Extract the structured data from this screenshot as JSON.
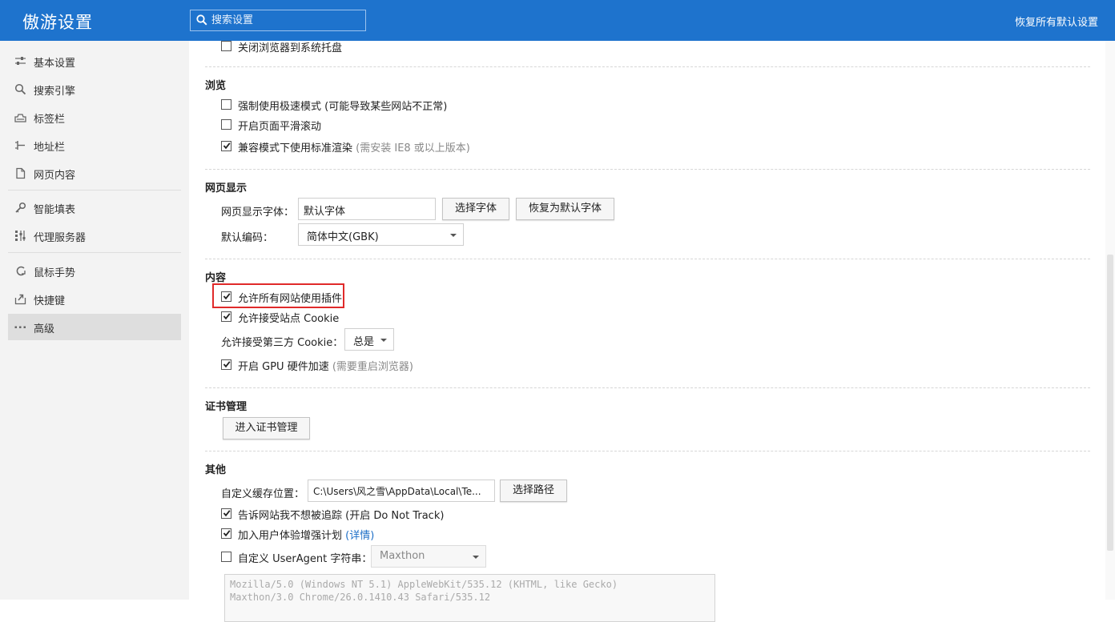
{
  "header": {
    "title": "傲游设置",
    "search_placeholder": "搜索设置",
    "restore_all": "恢复所有默认设置"
  },
  "sidebar": {
    "items": [
      {
        "label": "基本设置",
        "icon": "sliders-icon"
      },
      {
        "label": "搜索引擎",
        "icon": "search-icon"
      },
      {
        "label": "标签栏",
        "icon": "tabs-icon"
      },
      {
        "label": "地址栏",
        "icon": "address-bar-icon"
      },
      {
        "label": "网页内容",
        "icon": "document-icon"
      },
      {
        "label": "智能填表",
        "icon": "key-icon"
      },
      {
        "label": "代理服务器",
        "icon": "proxy-icon"
      },
      {
        "label": "鼠标手势",
        "icon": "mouse-gesture-icon"
      },
      {
        "label": "快捷键",
        "icon": "shortcut-icon"
      },
      {
        "label": "高级",
        "icon": "more-icon",
        "active": true
      }
    ]
  },
  "top_partial": {
    "close_to_tray": {
      "label": "关闭浏览器到系统托盘",
      "checked": false
    }
  },
  "browse": {
    "title": "浏览",
    "force_fast_mode": {
      "label": "强制使用极速模式 (可能导致某些网站不正常)",
      "checked": false
    },
    "smooth_scroll": {
      "label": "开启页面平滑滚动",
      "checked": false
    },
    "compat_standard": {
      "label": "兼容模式下使用标准渲染",
      "hint": "(需安装 IE8 或以上版本)",
      "checked": true
    }
  },
  "display": {
    "title": "网页显示",
    "font_label": "网页显示字体：",
    "font_value": "默认字体",
    "choose_font": "选择字体",
    "restore_font": "恢复为默认字体",
    "encoding_label": "默认编码：",
    "encoding_value": "简体中文(GBK)"
  },
  "content": {
    "title": "内容",
    "allow_plugins": {
      "label": "允许所有网站使用插件",
      "checked": true
    },
    "allow_cookie": {
      "label": "允许接受站点 Cookie",
      "checked": true
    },
    "third_party_label": "允许接受第三方 Cookie：",
    "third_party_value": "总是",
    "gpu": {
      "label": "开启 GPU 硬件加速",
      "hint": "(需要重启浏览器)",
      "checked": true
    }
  },
  "cert": {
    "title": "证书管理",
    "button": "进入证书管理"
  },
  "other": {
    "title": "其他",
    "cache_label": "自定义缓存位置：",
    "cache_value": "C:\\Users\\风之雪\\AppData\\Local\\Te...",
    "choose_path": "选择路径",
    "dnt": {
      "label": "告诉网站我不想被追踪 (开启 Do Not Track)",
      "checked": true
    },
    "ux_plan": {
      "label": "加入用户体验增强计划",
      "link": "(详情)",
      "checked": true
    },
    "user_agent": {
      "label": "自定义 UserAgent 字符串：",
      "checked": false,
      "select_value": "Maxthon"
    },
    "ua_text_line1": "Mozilla/5.0 (Windows NT 5.1) AppleWebKit/535.12 (KHTML, like Gecko)",
    "ua_text_line2": "Maxthon/3.0 Chrome/26.0.1410.43 Safari/535.12"
  },
  "colors": {
    "header_bg": "#1e73cd",
    "highlight_border": "#e02a2a",
    "link": "#1e6fc7"
  }
}
